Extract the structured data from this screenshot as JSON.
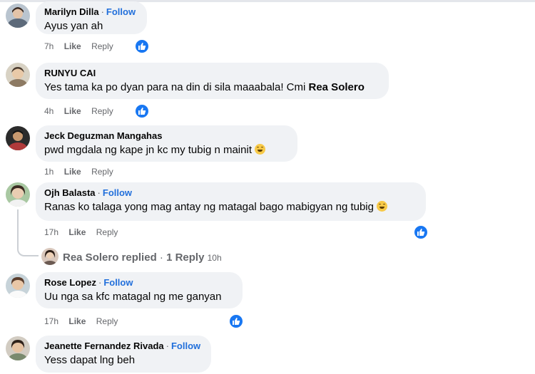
{
  "comments": [
    {
      "name": "Marilyn Dilla",
      "follow": "Follow",
      "text": "Ayus yan ah",
      "time": "7h",
      "like": "Like",
      "reply": "Reply",
      "reaction": "like"
    },
    {
      "name": "RUNYU CAI",
      "text_prefix": "Yes tama ka po dyan para na din di sila maaabala! Cmi ",
      "mention": "Rea Solero",
      "time": "4h",
      "like": "Like",
      "reply": "Reply",
      "reaction": "like"
    },
    {
      "name": "Jeck Deguzman Mangahas",
      "text": "pwd mgdala ng kape jn kc my tubig n mainit",
      "emoji": "grinning-face",
      "time": "1h",
      "like": "Like",
      "reply": "Reply"
    },
    {
      "name": "Ojh Balasta",
      "follow": "Follow",
      "text": "Ranas ko talaga yong mag antay ng matagal bago mabigyan ng tubig",
      "emoji": "grinning-face",
      "time": "17h",
      "like": "Like",
      "reply": "Reply",
      "reaction": "like",
      "replies": {
        "author": "Rea Solero",
        "replied": "replied",
        "separator": "·",
        "count": "1 Reply",
        "time": "10h"
      }
    },
    {
      "name": "Rose Lopez",
      "follow": "Follow",
      "text": "Uu nga sa kfc matagal ng me ganyan",
      "time": "17h",
      "like": "Like",
      "reply": "Reply",
      "reaction": "like"
    },
    {
      "name": "Jeanette Fernandez Rivada",
      "follow": "Follow",
      "text": "Yess dapat lng beh"
    }
  ],
  "separator": "·",
  "colors": {
    "bubble": "#f0f2f5",
    "link": "#216fdb",
    "meta": "#65676b",
    "like_badge": "#1877f2"
  }
}
